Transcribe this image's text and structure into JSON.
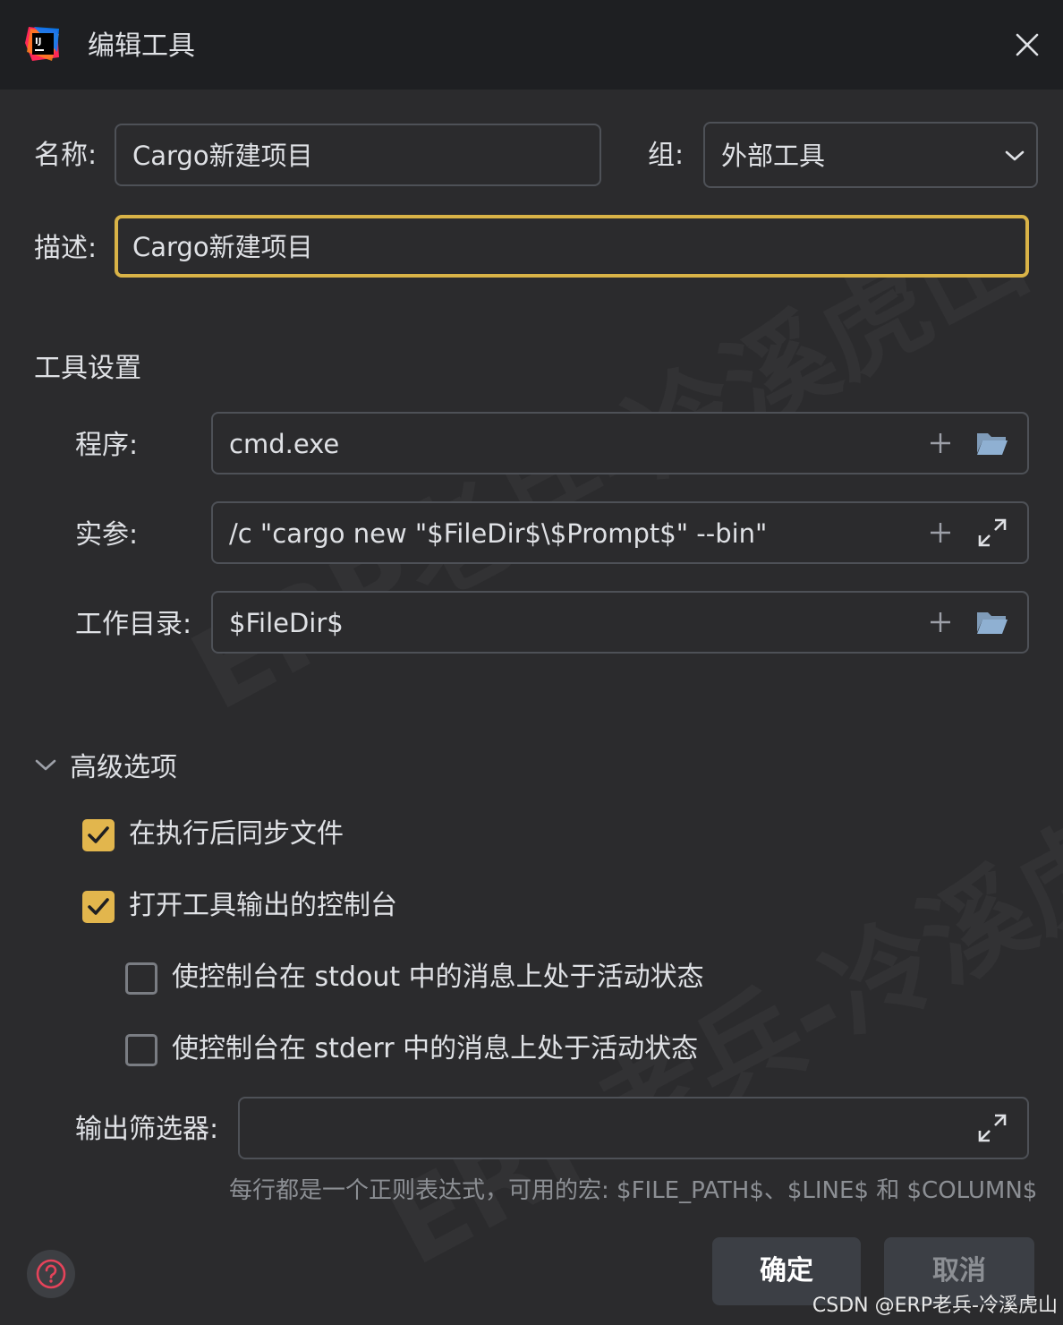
{
  "window": {
    "title": "编辑工具"
  },
  "form": {
    "name_label": "名称:",
    "name_value": "Cargo新建项目",
    "group_label": "组:",
    "group_value": "外部工具",
    "desc_label": "描述:",
    "desc_value": "Cargo新建项目"
  },
  "tool_settings": {
    "title": "工具设置",
    "program_label": "程序:",
    "program_value": "cmd.exe",
    "args_label": "实参:",
    "args_value": "/c \"cargo new \"$FileDir$\\$Prompt$\" --bin\"",
    "workdir_label": "工作目录:",
    "workdir_value": "$FileDir$"
  },
  "advanced": {
    "title": "高级选项",
    "options": [
      {
        "label": "在执行后同步文件",
        "checked": true
      },
      {
        "label": "打开工具输出的控制台",
        "checked": true
      },
      {
        "label": "使控制台在 stdout 中的消息上处于活动状态",
        "checked": false
      },
      {
        "label": "使控制台在 stderr 中的消息上处于活动状态",
        "checked": false
      }
    ],
    "filter_label": "输出筛选器:",
    "filter_value": "",
    "hint": "每行都是一个正则表达式，可用的宏: $FILE_PATH$、$LINE$ 和 $COLUMN$"
  },
  "buttons": {
    "ok": "确定",
    "cancel": "取消"
  },
  "footer": "CSDN @ERP老兵-冷溪虎山",
  "watermark": "ERP老兵-冷溪虎山",
  "colors": {
    "accent": "#e2b64d",
    "focus_border": "#d9b347",
    "background": "#2b2b2d",
    "titlebar": "#1e1f22"
  }
}
